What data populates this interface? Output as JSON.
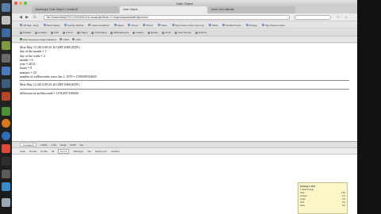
{
  "window": {
    "title": "Date Object"
  },
  "tabs": [
    {
      "label": "JavaScript: Date Object | CreateJS",
      "active": false
    },
    {
      "label": "Date Object",
      "active": true
    },
    {
      "label": "Dave Geil Ultimate",
      "active": false
    }
  ],
  "nav": {
    "url": "file:///Users/Nazy/TCCL/2013/DM1116-Javascript/Week 10-Object/classes/dateObject.html",
    "back": "◀",
    "forward": "▶",
    "reload": "↻"
  },
  "bookmarks": [
    "JM Mail - Nazy",
    "Most Visited",
    "Getting Started",
    "Latest Headlines",
    "Apple",
    "iCloud",
    "Yahoo!",
    "News",
    "http://www.msnbc.msn.com",
    "IMDb",
    "Mozilla Firefox",
    "Firebug",
    "http://www.mozdev..."
  ],
  "devtools": [
    "Disable",
    "Cookies",
    "CSS",
    "Forms",
    "Images",
    "Information",
    "Miscellaneous",
    "Outline",
    "Resize",
    "Tools",
    "View Source",
    "Options"
  ],
  "devtools2": [
    "Web Developer Page Validation",
    "HTML",
    "CSS"
  ],
  "content": {
    "block1": [
      "Mon May 15 2014 09:25:16 GMT-0400 (EDT)",
      "day of the month = 1",
      "day of the week = 2",
      "month = 4",
      "year = 2014",
      "hours = 9",
      "minutes = 25",
      "number of milliseconds since Jan 1, 1970 = 1399290316620"
    ],
    "block2": [
      "Mon May 12 2014 09:25:16 GMT-0400 (EDT)"
    ],
    "block3": [
      "difference in milliseconds = 11912017180638"
    ]
  },
  "firebug": {
    "toolbar": [
      "Console ▾",
      "HTML",
      "CSS",
      "Script",
      "DOM",
      "Net"
    ],
    "tabs": [
      "Clear",
      "Persist",
      "Profile",
      "All",
      "Errors",
      "Warnings",
      "Info",
      "Debug Info",
      "Cookies"
    ],
    "active_tab": "Errors"
  },
  "panel": {
    "title": "Firebug 1.12.8",
    "subtitle": "1 Total Timing",
    "rows": [
      [
        "total",
        "1.00"
      ],
      [
        "onload",
        "0.0"
      ],
      [
        "script",
        "0.0"
      ],
      [
        "html",
        "0.0"
      ],
      [
        "other",
        "0.0"
      ]
    ]
  }
}
